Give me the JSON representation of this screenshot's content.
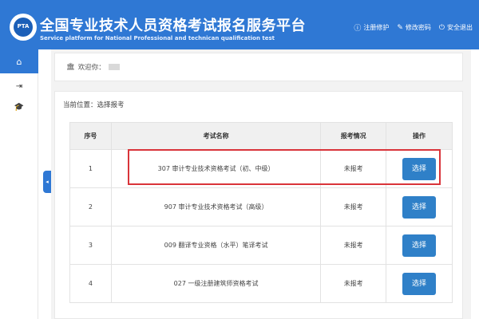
{
  "header": {
    "logo_text": "PTA",
    "title": "全国专业技术人员资格考试报名服务平台",
    "subtitle": "Service platform for National Professional and technican qualification test",
    "links": [
      {
        "icon": "info-icon",
        "label": "注册修护"
      },
      {
        "icon": "edit-icon",
        "label": "修改密码"
      },
      {
        "icon": "power-icon",
        "label": "安全退出"
      }
    ]
  },
  "sidebar": {
    "items": [
      {
        "icon": "home-icon"
      },
      {
        "icon": "login-icon"
      },
      {
        "icon": "graduation-cap-icon"
      }
    ]
  },
  "welcome": {
    "label": "欢迎你："
  },
  "breadcrumb": "当前位置：选择报考",
  "table": {
    "headers": [
      "序号",
      "考试名称",
      "报考情况",
      "操作"
    ],
    "rows": [
      {
        "no": "1",
        "name": "307 审计专业技术资格考试（初、中级）",
        "status": "未报考",
        "action": "选择"
      },
      {
        "no": "2",
        "name": "907 审计专业技术资格考试（高级）",
        "status": "未报考",
        "action": "选择"
      },
      {
        "no": "3",
        "name": "009 翻译专业资格（水平）笔译考试",
        "status": "未报考",
        "action": "选择"
      },
      {
        "no": "4",
        "name": "027 一级注册建筑师资格考试",
        "status": "未报考",
        "action": "选择"
      }
    ]
  },
  "colors": {
    "header_bg": "#2f78d4",
    "button_bg": "#2f80c8",
    "highlight": "#d9343a"
  }
}
